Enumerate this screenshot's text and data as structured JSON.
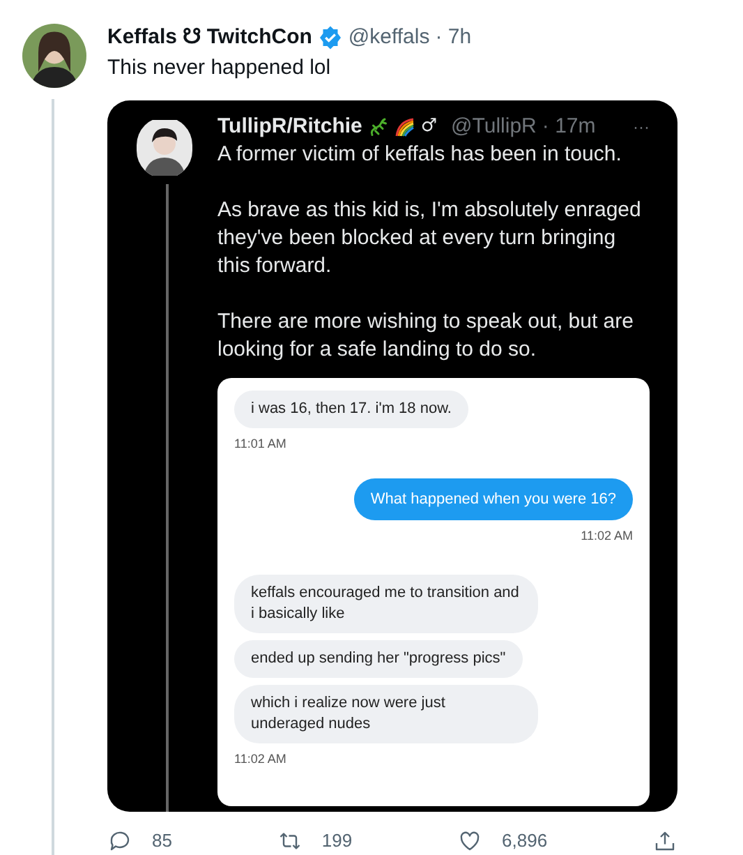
{
  "tweet": {
    "name": "Keffals ☋ TwitchCon",
    "verified": true,
    "handle": "@keffals",
    "time": "· 7h",
    "text": "This never happened lol"
  },
  "quoted_image": {
    "name": "TullipR/Ritchie",
    "gender_mark": "♂",
    "handle": "@TullipR",
    "time": "· 17m",
    "more": "···",
    "paragraphs": [
      "A former victim of keffals has been in touch.",
      "As brave as this kid is, I'm absolutely enraged they've been blocked at every turn bringing this forward.",
      "There are more wishing to speak out, but are looking for a safe landing to do so."
    ],
    "messages": [
      {
        "kind": "received",
        "text": "i was 16, then 17. i'm 18 now."
      },
      {
        "kind": "time_left",
        "text": "11:01 AM"
      },
      {
        "kind": "sent",
        "text": "What happened when you were 16?"
      },
      {
        "kind": "time_right",
        "text": "11:02 AM"
      },
      {
        "kind": "received",
        "text": "keffals encouraged me to transition and i basically like"
      },
      {
        "kind": "received",
        "text": "ended up sending her \"progress pics\""
      },
      {
        "kind": "received",
        "text": "which i realize now were just underaged nudes"
      },
      {
        "kind": "time_left",
        "text": "11:02 AM"
      }
    ]
  },
  "actions": [
    {
      "kind": "reply",
      "count": "85"
    },
    {
      "kind": "retweet",
      "count": "199"
    },
    {
      "kind": "like",
      "count": "6,896"
    },
    {
      "kind": "share"
    }
  ]
}
